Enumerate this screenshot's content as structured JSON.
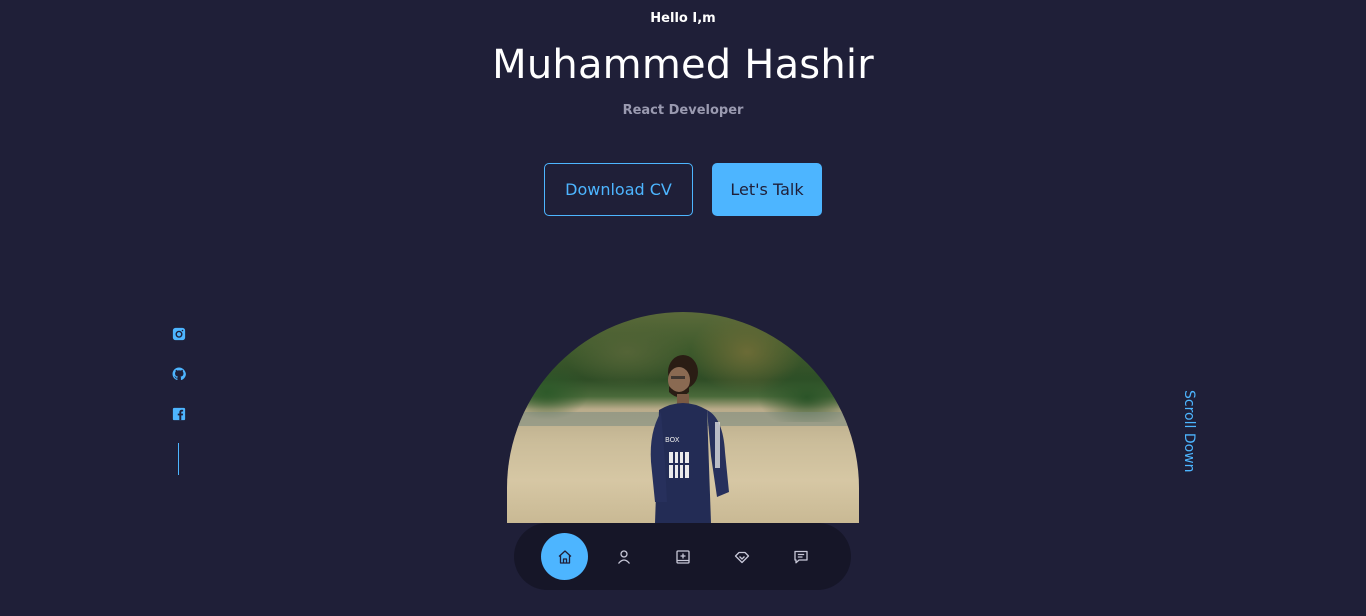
{
  "header": {
    "greeting": "Hello I,m",
    "name": "Muhammed Hashir",
    "role": "React Developer"
  },
  "cta": {
    "download_label": "Download CV",
    "talk_label": "Let's Talk"
  },
  "socials": [
    "instagram-icon",
    "github-icon",
    "facebook-icon"
  ],
  "scroll": {
    "label": "Scroll Down"
  },
  "nav": {
    "items": [
      "home-icon",
      "user-icon",
      "book-icon",
      "services-icon",
      "message-icon"
    ],
    "active": "home-icon"
  },
  "colors": {
    "background": "#1f1f38",
    "accent": "#4db5ff",
    "muted_text": "#9a9ab0"
  }
}
